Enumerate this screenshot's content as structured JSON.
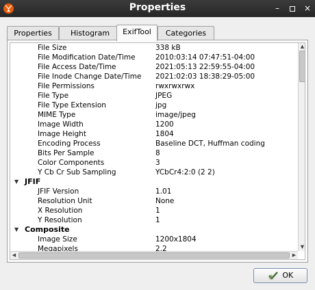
{
  "window": {
    "title": "Properties",
    "minimize": "–",
    "close": "×"
  },
  "tabs": [
    {
      "label": "Properties"
    },
    {
      "label": "Histogram"
    },
    {
      "label": "ExifTool"
    },
    {
      "label": "Categories"
    }
  ],
  "active_tab": "ExifTool",
  "exif": {
    "rows": [
      {
        "k": "File Size",
        "v": "338 kB"
      },
      {
        "k": "File Modification Date/Time",
        "v": "2010:03:14 07:47:51-04:00"
      },
      {
        "k": "File Access Date/Time",
        "v": "2021:05:13 22:59:55-04:00"
      },
      {
        "k": "File Inode Change Date/Time",
        "v": "2021:02:03 18:38:29-05:00"
      },
      {
        "k": "File Permissions",
        "v": "rwxrwxrwx"
      },
      {
        "k": "File Type",
        "v": "JPEG"
      },
      {
        "k": "File Type Extension",
        "v": "jpg"
      },
      {
        "k": "MIME Type",
        "v": "image/jpeg"
      },
      {
        "k": "Image Width",
        "v": "1200"
      },
      {
        "k": "Image Height",
        "v": "1804"
      },
      {
        "k": "Encoding Process",
        "v": "Baseline DCT, Huffman coding"
      },
      {
        "k": "Bits Per Sample",
        "v": "8"
      },
      {
        "k": "Color Components",
        "v": "3"
      },
      {
        "k": "Y Cb Cr Sub Sampling",
        "v": "YCbCr4:2:0 (2 2)"
      }
    ],
    "jfif_section": "JFIF",
    "jfif_rows": [
      {
        "k": "JFIF Version",
        "v": "1.01"
      },
      {
        "k": "Resolution Unit",
        "v": "None"
      },
      {
        "k": "X Resolution",
        "v": "1"
      },
      {
        "k": "Y Resolution",
        "v": "1"
      }
    ],
    "composite_section": "Composite",
    "composite_rows": [
      {
        "k": "Image Size",
        "v": "1200x1804"
      },
      {
        "k": "Megapixels",
        "v": "2.2"
      }
    ]
  },
  "ok_label": "OK"
}
